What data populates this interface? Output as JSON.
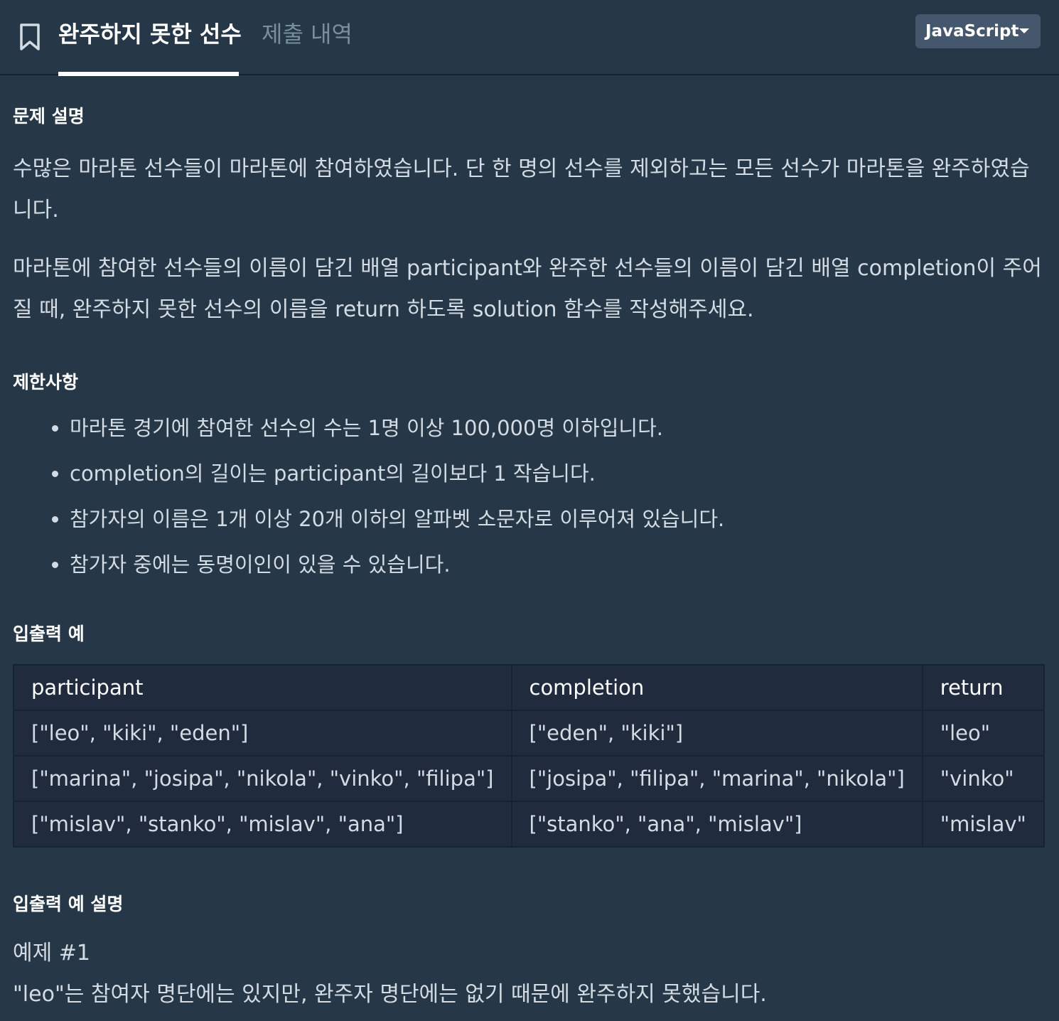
{
  "header": {
    "active_tab": "완주하지 못한 선수",
    "inactive_tab": "제출 내역",
    "language": "JavaScript"
  },
  "sections": {
    "description_title": "문제 설명",
    "description_p1": "수많은 마라톤 선수들이 마라톤에 참여하였습니다. 단 한 명의 선수를 제외하고는 모든 선수가 마라톤을 완주하였습니다.",
    "description_p2": "마라톤에 참여한 선수들의 이름이 담긴 배열 participant와 완주한 선수들의 이름이 담긴 배열 completion이 주어질 때, 완주하지 못한 선수의 이름을 return 하도록 solution 함수를 작성해주세요.",
    "constraints_title": "제한사항",
    "constraints": [
      "마라톤 경기에 참여한 선수의 수는 1명 이상 100,000명 이하입니다.",
      "completion의 길이는 participant의 길이보다 1 작습니다.",
      "참가자의 이름은 1개 이상 20개 이하의 알파벳 소문자로 이루어져 있습니다.",
      "참가자 중에는 동명이인이 있을 수 있습니다."
    ],
    "io_title": "입출력 예",
    "io_explain_title": "입출력 예 설명",
    "example1_title": "예제 #1",
    "example1_text": "\"leo\"는 참여자 명단에는 있지만, 완주자 명단에는 없기 때문에 완주하지 못했습니다."
  },
  "table": {
    "headers": [
      "participant",
      "completion",
      "return"
    ],
    "rows": [
      [
        "[\"leo\", \"kiki\", \"eden\"]",
        "[\"eden\", \"kiki\"]",
        "\"leo\""
      ],
      [
        "[\"marina\", \"josipa\", \"nikola\", \"vinko\", \"filipa\"]",
        "[\"josipa\", \"filipa\", \"marina\", \"nikola\"]",
        "\"vinko\""
      ],
      [
        "[\"mislav\", \"stanko\", \"mislav\", \"ana\"]",
        "[\"stanko\", \"ana\", \"mislav\"]",
        "\"mislav\""
      ]
    ]
  }
}
